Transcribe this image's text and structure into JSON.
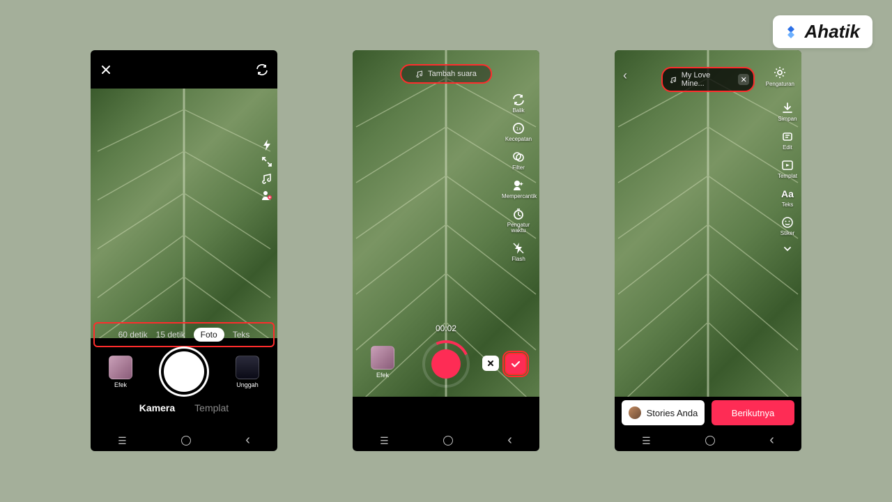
{
  "brand": {
    "name": "Ahatik"
  },
  "screen1": {
    "modes": [
      "60 detik",
      "15 detik",
      "Foto",
      "Teks"
    ],
    "active_mode": "Foto",
    "efek": "Efek",
    "unggah": "Unggah",
    "tabs": {
      "kamera": "Kamera",
      "templat": "Templat"
    },
    "active_tab": "Kamera"
  },
  "screen2": {
    "sound_pill": "Tambah suara",
    "timecode": "00:02",
    "efek": "Efek",
    "tools": [
      {
        "icon": "flip",
        "label": "Balik"
      },
      {
        "icon": "speed",
        "label": "Kecepatan"
      },
      {
        "icon": "filter",
        "label": "Filter"
      },
      {
        "icon": "beauty",
        "label": "Mempercantik"
      },
      {
        "icon": "timer",
        "label": "Pengatur waktu"
      },
      {
        "icon": "flash",
        "label": "Flash"
      }
    ]
  },
  "screen3": {
    "sound_pill": "My Love Mine...",
    "settings": "Pengaturan",
    "tools": [
      {
        "icon": "save",
        "label": "Simpan"
      },
      {
        "icon": "edit",
        "label": "Edit"
      },
      {
        "icon": "template",
        "label": "Templat"
      },
      {
        "icon": "text",
        "label": "Teks"
      },
      {
        "icon": "sticker",
        "label": "Stiker"
      }
    ],
    "stories": "Stories Anda",
    "next": "Berikutnya"
  }
}
